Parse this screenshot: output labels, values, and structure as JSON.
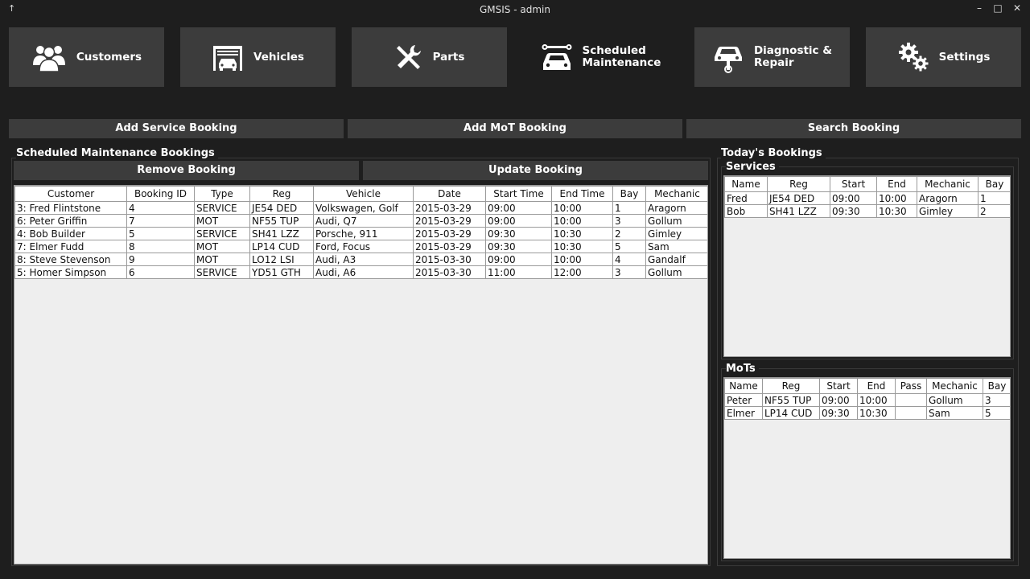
{
  "window": {
    "title": "GMSIS - admin"
  },
  "nav": [
    {
      "label_1": "Customers",
      "label_2": "",
      "icon": "users-icon"
    },
    {
      "label_1": "Vehicles",
      "label_2": "",
      "icon": "garage-car-icon"
    },
    {
      "label_1": "Parts",
      "label_2": "",
      "icon": "tools-icon"
    },
    {
      "label_1": "Scheduled",
      "label_2": "Maintenance",
      "icon": "car-wrench-icon"
    },
    {
      "label_1": "Diagnostic &",
      "label_2": "Repair",
      "icon": "car-lift-icon"
    },
    {
      "label_1": "Settings",
      "label_2": "",
      "icon": "gears-icon"
    }
  ],
  "actions": {
    "add_service": "Add Service Booking",
    "add_mot": "Add MoT Booking",
    "search": "Search Booking"
  },
  "bookings_panel": {
    "title": "Scheduled Maintenance Bookings",
    "remove": "Remove Booking",
    "update": "Update Booking",
    "columns": [
      "Customer",
      "Booking ID",
      "Type",
      "Reg",
      "Vehicle",
      "Date",
      "Start Time",
      "End Time",
      "Bay",
      "Mechanic"
    ],
    "rows": [
      [
        "3: Fred Flintstone",
        "4",
        "SERVICE",
        "JE54 DED",
        "Volkswagen, Golf",
        "2015-03-29",
        "09:00",
        "10:00",
        "1",
        "Aragorn"
      ],
      [
        "6: Peter Griffin",
        "7",
        "MOT",
        "NF55 TUP",
        "Audi, Q7",
        "2015-03-29",
        "09:00",
        "10:00",
        "3",
        "Gollum"
      ],
      [
        "4: Bob Builder",
        "5",
        "SERVICE",
        "SH41 LZZ",
        "Porsche, 911",
        "2015-03-29",
        "09:30",
        "10:30",
        "2",
        "Gimley"
      ],
      [
        "7: Elmer Fudd",
        "8",
        "MOT",
        "LP14 CUD",
        "Ford, Focus",
        "2015-03-29",
        "09:30",
        "10:30",
        "5",
        "Sam"
      ],
      [
        "8: Steve Stevenson",
        "9",
        "MOT",
        "LO12 LSI",
        "Audi, A3",
        "2015-03-30",
        "09:00",
        "10:00",
        "4",
        "Gandalf"
      ],
      [
        "5: Homer Simpson",
        "6",
        "SERVICE",
        "YD51 GTH",
        "Audi, A6",
        "2015-03-30",
        "11:00",
        "12:00",
        "3",
        "Gollum"
      ]
    ]
  },
  "today_panel": {
    "title": "Today's Bookings",
    "services": {
      "title": "Services",
      "columns": [
        "Name",
        "Reg",
        "Start",
        "End",
        "Mechanic",
        "Bay"
      ],
      "rows": [
        [
          "Fred",
          "JE54 DED",
          "09:00",
          "10:00",
          "Aragorn",
          "1"
        ],
        [
          "Bob",
          "SH41 LZZ",
          "09:30",
          "10:30",
          "Gimley",
          "2"
        ]
      ]
    },
    "mots": {
      "title": "MoTs",
      "columns": [
        "Name",
        "Reg",
        "Start",
        "End",
        "Pass",
        "Mechanic",
        "Bay"
      ],
      "rows": [
        [
          "Peter",
          "NF55 TUP",
          "09:00",
          "10:00",
          "",
          "Gollum",
          "3"
        ],
        [
          "Elmer",
          "LP14 CUD",
          "09:30",
          "10:30",
          "",
          "Sam",
          "5"
        ]
      ]
    }
  }
}
